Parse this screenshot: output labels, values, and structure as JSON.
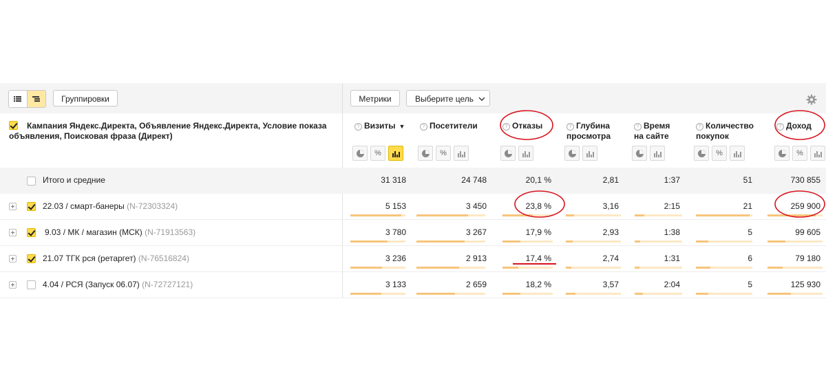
{
  "toolbar": {
    "view_list_icon": "list-icon",
    "view_tree_icon": "tree-icon",
    "groupings_label": "Группировки",
    "metrics_label": "Метрики",
    "goal_select_label": "Выберите цель",
    "settings_icon": "gear-icon"
  },
  "dimension_header": "Кампания Яндекс.Директа, Объявление Яндекс.Директа, Условие показа объявления, Поисковая фраза (Директ)",
  "columns": [
    {
      "label_line1": "Визиты",
      "label_line2": "",
      "sort": "▼"
    },
    {
      "label_line1": "Посетители",
      "label_line2": ""
    },
    {
      "label_line1": "Отказы",
      "label_line2": ""
    },
    {
      "label_line1": "Глубина",
      "label_line2": "просмотра"
    },
    {
      "label_line1": "Время",
      "label_line2": "на сайте"
    },
    {
      "label_line1": "Количество",
      "label_line2": "покупок"
    },
    {
      "label_line1": "Доход",
      "label_line2": ""
    }
  ],
  "help_glyph": "?",
  "percent_glyph": "%",
  "total": {
    "label": "Итого и средние",
    "values": [
      "31 318",
      "24 748",
      "20,1 %",
      "2,81",
      "1:37",
      "51",
      "730 855"
    ]
  },
  "rows": [
    {
      "name": "22.03 / смарт-банеры",
      "id": "(N-72303324)",
      "checked": true,
      "values": [
        "5 153",
        "3 450",
        "23,8 %",
        "3,16",
        "2:15",
        "21",
        "259 900"
      ],
      "fills": [
        0.92,
        0.75,
        0.6,
        0.15,
        0.2,
        0.95,
        0.88
      ]
    },
    {
      "name": "9.03 / МК / магазин (МСК)",
      "id": "(N-71913563)",
      "checked": true,
      "values": [
        "3 780",
        "3 267",
        "17,9 %",
        "2,93",
        "1:38",
        "5",
        "99 605"
      ],
      "fills": [
        0.68,
        0.7,
        0.35,
        0.12,
        0.12,
        0.22,
        0.33
      ]
    },
    {
      "name": "21.07 ТГК рся (ретаргет)",
      "id": "(N-76516824)",
      "checked": true,
      "values": [
        "3 236",
        "2 913",
        "17,4 %",
        "2,74",
        "1:31",
        "6",
        "79 180"
      ],
      "fills": [
        0.58,
        0.62,
        0.32,
        0.1,
        0.1,
        0.26,
        0.27
      ]
    },
    {
      "name": "4.04 / РСЯ (Запуск 06.07)",
      "id": "(N-72727121)",
      "checked": false,
      "values": [
        "3 133",
        "2 659",
        "18,2 %",
        "3,57",
        "2:04",
        "5",
        "125 930"
      ],
      "fills": [
        0.56,
        0.56,
        0.36,
        0.18,
        0.18,
        0.22,
        0.42
      ]
    }
  ],
  "colors": {
    "accent": "#ffdb4d",
    "bar": "#f7c47a",
    "annotation": "#d8141e"
  }
}
